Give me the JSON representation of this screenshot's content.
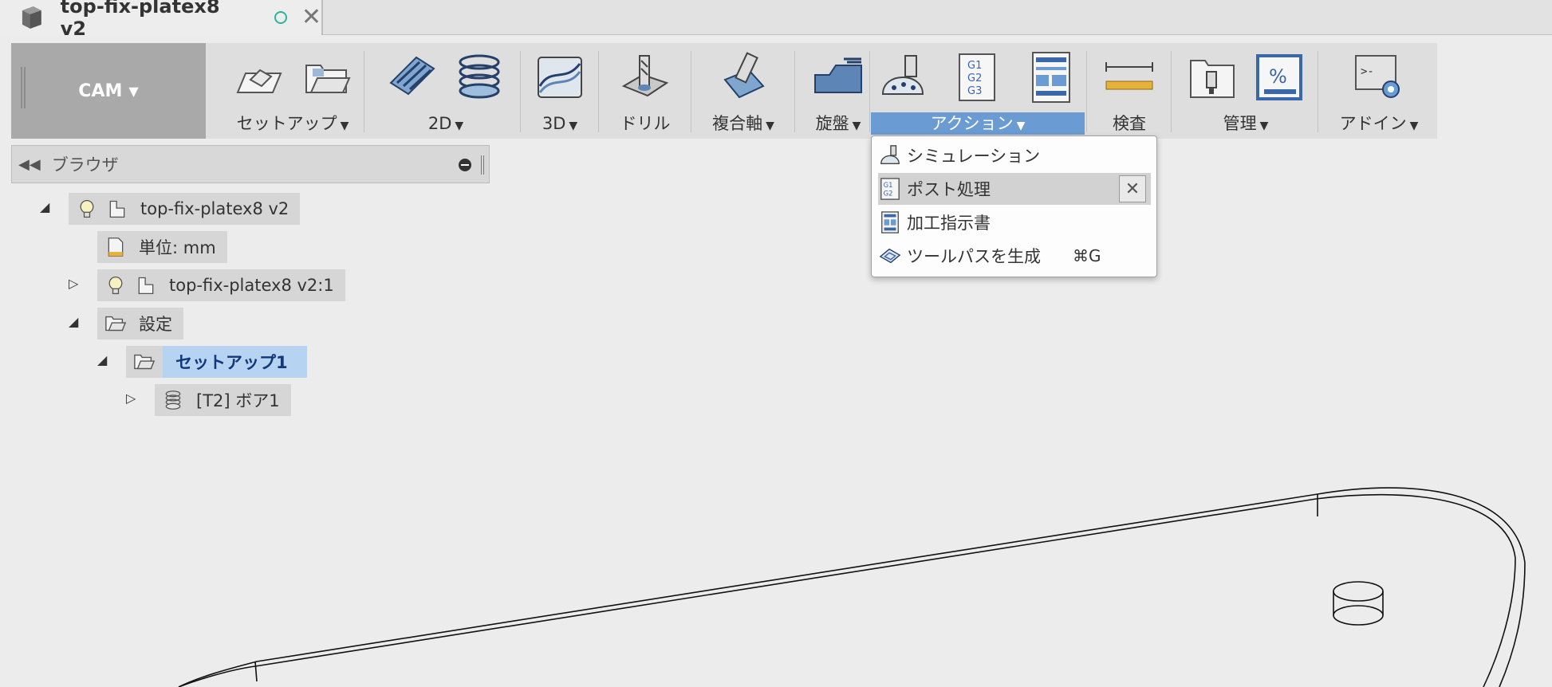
{
  "tab": {
    "title": "top-fix-platex8 v2",
    "close": "✕"
  },
  "toolbar": {
    "workspace": "CAM",
    "groups": {
      "setup": "セットアップ",
      "2d": "2D",
      "3d": "3D",
      "drill": "ドリル",
      "multiaxis": "複合軸",
      "turning": "旋盤",
      "actions": "アクション",
      "inspect": "検査",
      "manage": "管理",
      "addins": "アドイン"
    }
  },
  "action_menu": {
    "items": [
      {
        "label": "シミュレーション"
      },
      {
        "label": "ポスト処理"
      },
      {
        "label": "加工指示書"
      },
      {
        "label": "ツールパスを生成",
        "shortcut": "⌘G"
      }
    ],
    "pin": "✕"
  },
  "browser": {
    "title": "ブラウザ",
    "tree": {
      "root": "top-fix-platex8 v2",
      "units": "単位: mm",
      "component": "top-fix-platex8 v2:1",
      "setups": "設定",
      "setup1": "セットアップ1",
      "operation": "[T2] ボア1"
    }
  },
  "icons": {
    "doc": "document-cube-icon",
    "workspace_caret": "caret-down-icon"
  }
}
